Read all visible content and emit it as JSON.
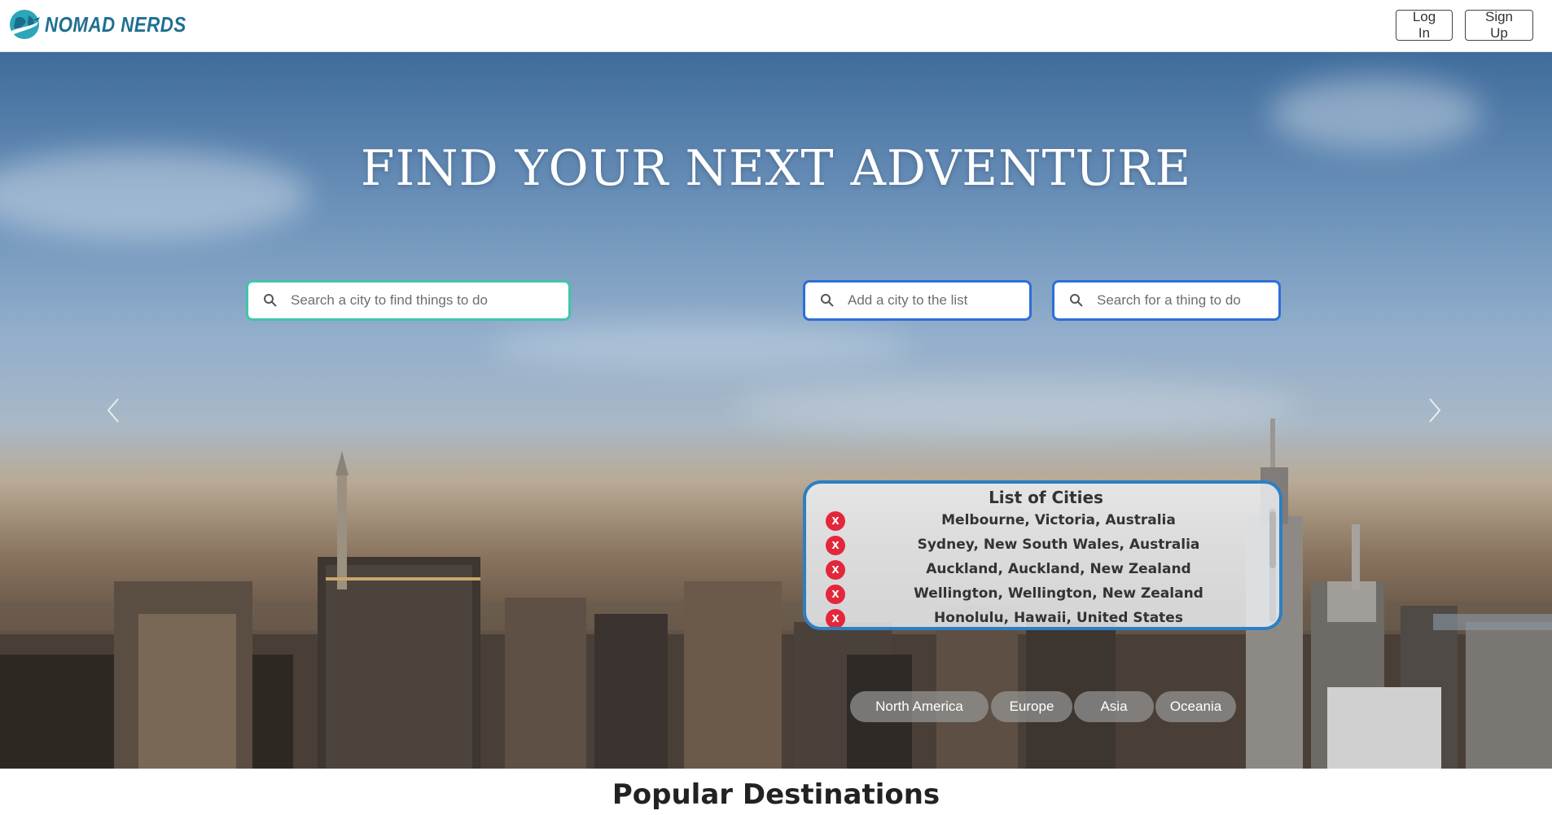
{
  "brand": {
    "name": "NOMAD NERDS"
  },
  "nav": {
    "login_label": "Log In",
    "signup_label": "Sign Up"
  },
  "hero": {
    "title": "FIND YOUR NEXT ADVENTURE",
    "city_search_placeholder": "Search a city to find things to do",
    "add_city_placeholder": "Add a city to the list",
    "thing_search_placeholder": "Search for a thing to do",
    "carousel_slides": 4,
    "active_slide": 3
  },
  "cities_panel": {
    "title": "List of Cities",
    "remove_label": "X",
    "cities": [
      "Melbourne, Victoria, Australia",
      "Sydney, New South Wales, Australia",
      "Auckland, Auckland, New Zealand",
      "Wellington, Wellington, New Zealand",
      "Honolulu, Hawaii, United States"
    ]
  },
  "regions": [
    "North America",
    "Europe",
    "Asia",
    "Oceania"
  ],
  "sections": {
    "popular_title": "Popular Destinations"
  },
  "colors": {
    "brand": "#1f6f93",
    "accent_teal": "#43c4a8",
    "accent_blue": "#2d6fd6",
    "remove_red": "#e3273a"
  }
}
